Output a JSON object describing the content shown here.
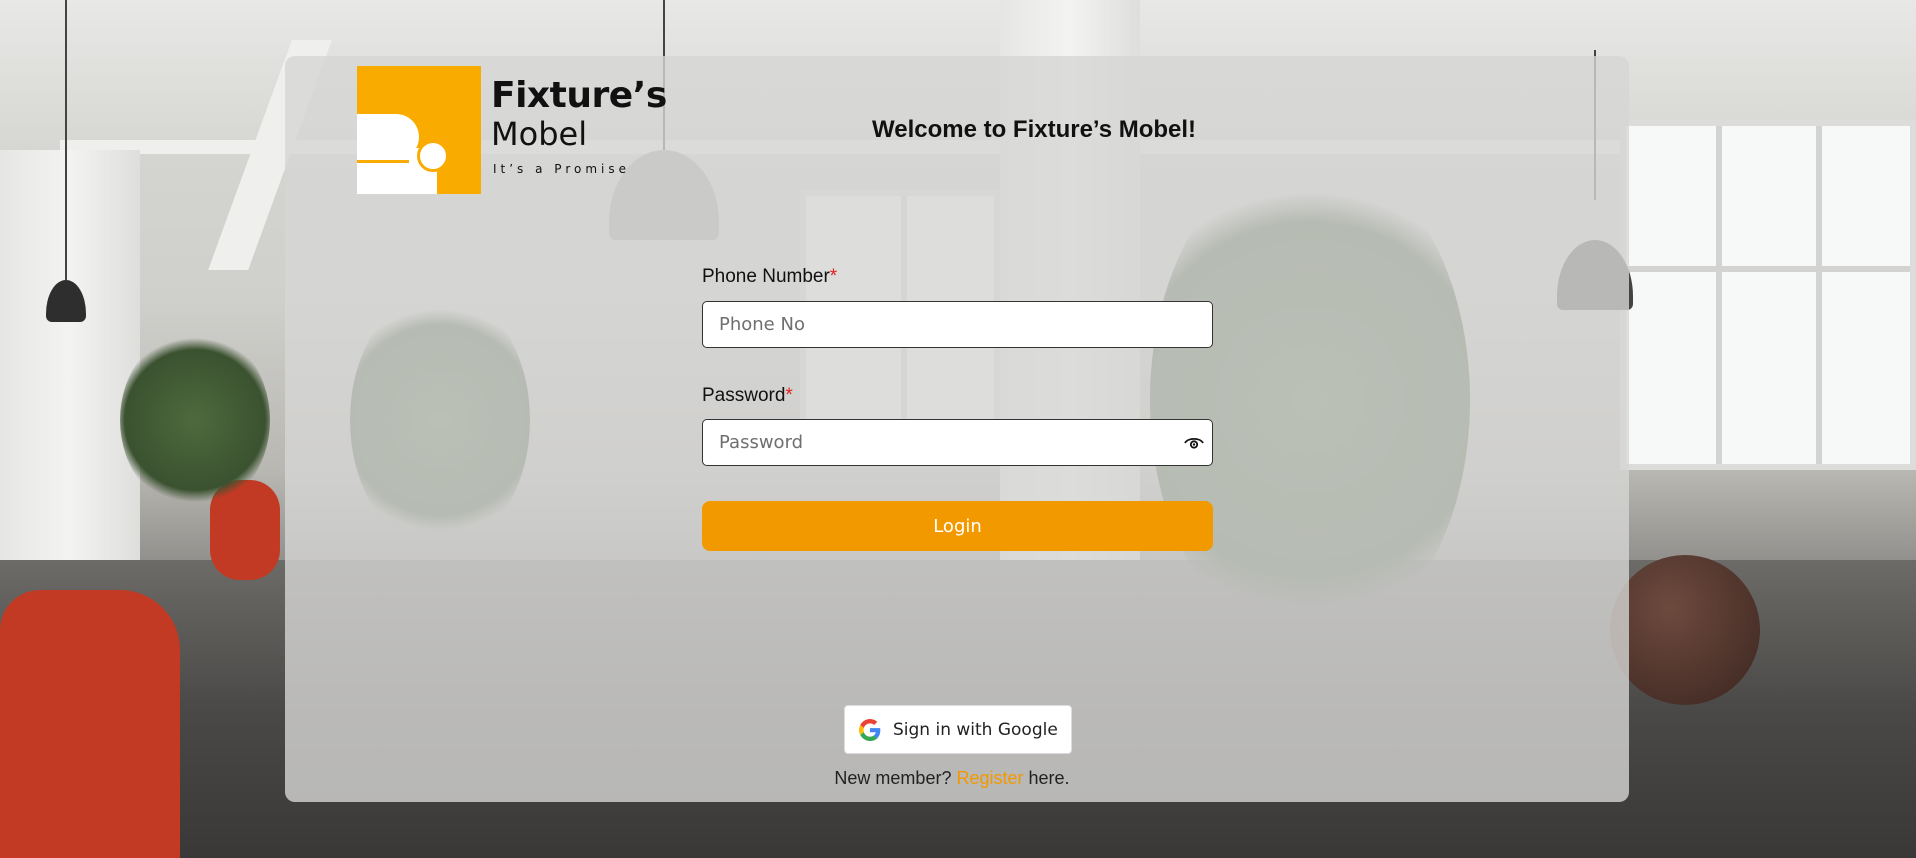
{
  "brand": {
    "name": "Fixture’s",
    "sub": "Mobel",
    "tagline": "It’s a Promise",
    "accent_color": "#f9ab00",
    "logo_icon": "sofa-icon"
  },
  "page": {
    "welcome": "Welcome to Fixture’s Mobel!"
  },
  "form": {
    "phone": {
      "label": "Phone Number",
      "required_mark": "*",
      "placeholder": "Phone No",
      "value": ""
    },
    "password": {
      "label": "Password",
      "required_mark": "*",
      "placeholder": "Password",
      "value": "",
      "toggle_icon": "eye-icon"
    },
    "login_label": "Login",
    "login_color": "#f29900"
  },
  "google": {
    "label": "Sign in with Google",
    "icon": "google-icon"
  },
  "register": {
    "prefix": "New member?",
    "link": "Register",
    "suffix": "here."
  }
}
